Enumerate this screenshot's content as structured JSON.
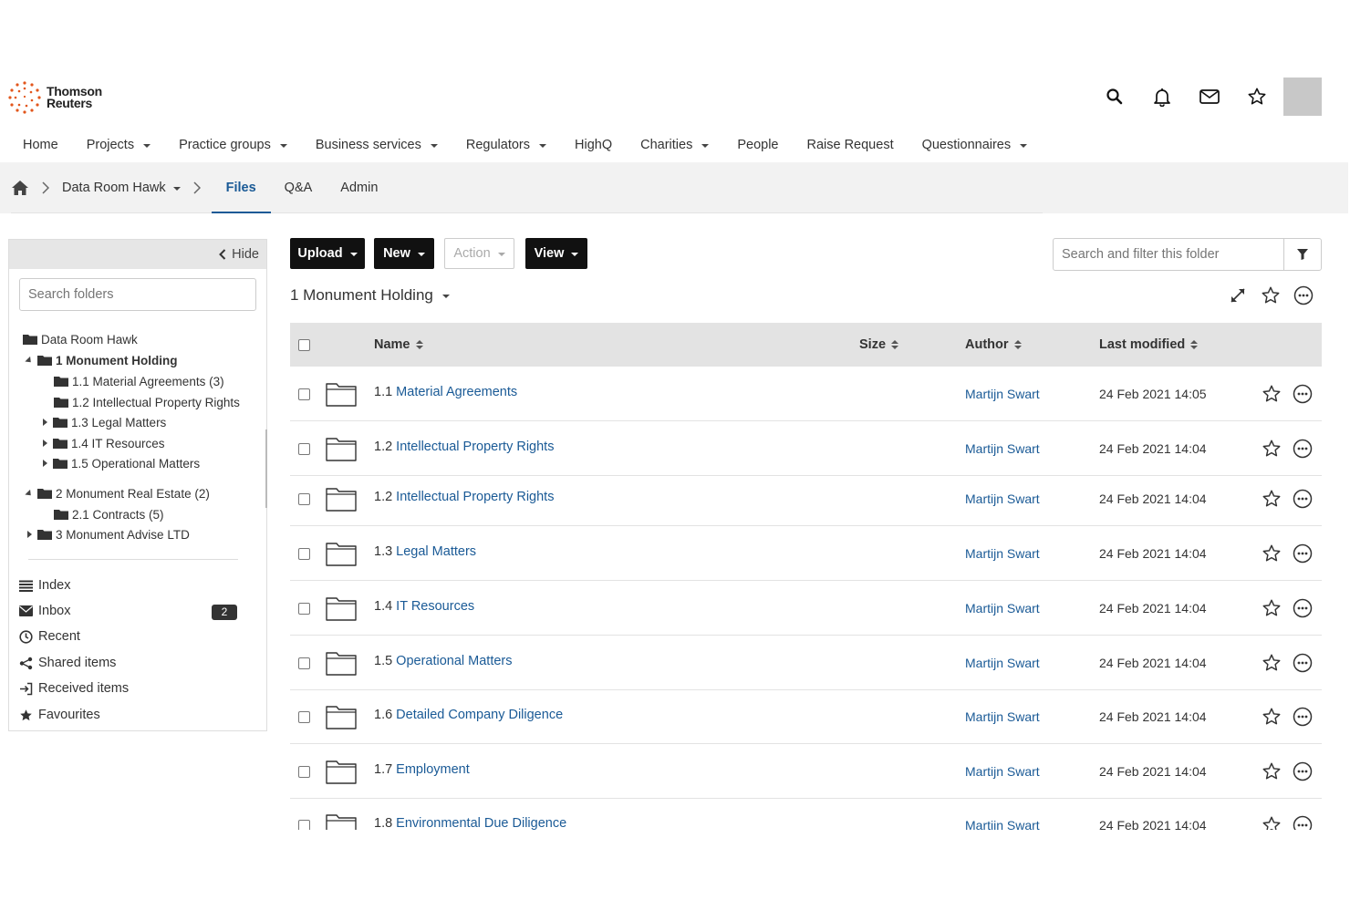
{
  "brand": {
    "name_line1": "Thomson",
    "name_line2": "Reuters"
  },
  "header_icons": [
    "search-icon",
    "bell-icon",
    "mail-icon",
    "star-icon"
  ],
  "topnav": [
    {
      "label": "Home",
      "dropdown": false
    },
    {
      "label": "Projects",
      "dropdown": true
    },
    {
      "label": "Practice groups",
      "dropdown": true
    },
    {
      "label": "Business services",
      "dropdown": true
    },
    {
      "label": "Regulators",
      "dropdown": true
    },
    {
      "label": "HighQ",
      "dropdown": false
    },
    {
      "label": "Charities",
      "dropdown": true
    },
    {
      "label": "People",
      "dropdown": false
    },
    {
      "label": "Raise Request",
      "dropdown": false
    },
    {
      "label": "Questionnaires",
      "dropdown": true
    }
  ],
  "breadcrumb": {
    "site": "Data Room Hawk",
    "tabs": [
      {
        "label": "Files",
        "active": true
      },
      {
        "label": "Q&A",
        "active": false
      },
      {
        "label": "Admin",
        "active": false
      }
    ]
  },
  "sidebar": {
    "hide_label": "Hide",
    "search_placeholder": "Search folders",
    "tree": [
      {
        "label": "Data Room Hawk",
        "level": 0,
        "toggle": "none",
        "bold": false
      },
      {
        "label": "1 Monument Holding",
        "level": 1,
        "toggle": "open",
        "bold": true
      },
      {
        "label": "1.1 Material Agreements (3)",
        "level": 2,
        "toggle": "none",
        "bold": false
      },
      {
        "label": "1.2 Intellectual Property Rights",
        "level": 2,
        "toggle": "none",
        "bold": false
      },
      {
        "label": "1.3 Legal Matters",
        "level": 2,
        "toggle": "closed",
        "bold": false
      },
      {
        "label": "1.4 IT Resources",
        "level": 2,
        "toggle": "closed",
        "bold": false
      },
      {
        "label": "1.5 Operational Matters",
        "level": 2,
        "toggle": "closed",
        "bold": false
      },
      {
        "label": "2 Monument Real Estate (2)",
        "level": 1,
        "toggle": "open",
        "bold": false
      },
      {
        "label": "2.1 Contracts (5)",
        "level": 2,
        "toggle": "none",
        "bold": false
      },
      {
        "label": "3 Monument Advise LTD",
        "level": 1,
        "toggle": "closed",
        "bold": false
      }
    ],
    "nav": [
      {
        "label": "Index",
        "icon": "list-icon"
      },
      {
        "label": "Inbox",
        "icon": "envelope-icon"
      },
      {
        "label": "Recent",
        "icon": "clock-icon"
      },
      {
        "label": "Shared items",
        "icon": "share-icon"
      },
      {
        "label": "Received items",
        "icon": "received-icon"
      },
      {
        "label": "Favourites",
        "icon": "star-filled-icon"
      }
    ],
    "inbox_count": "2"
  },
  "toolbar": {
    "upload": "Upload",
    "new": "New",
    "action": "Action",
    "view": "View",
    "filter_placeholder": "Search and filter this folder"
  },
  "folder": {
    "title": "1 Monument Holding"
  },
  "table": {
    "columns": {
      "name": "Name",
      "size": "Size",
      "author": "Author",
      "modified": "Last modified"
    },
    "rows": [
      {
        "num": "1.1",
        "name": "Material Agreements",
        "author": "Martijn Swart",
        "modified": "24 Feb 2021 14:05"
      },
      {
        "num": "1.2",
        "name": "Intellectual Property Rights",
        "author": "Martijn Swart",
        "modified": "24 Feb 2021 14:04"
      },
      {
        "num": "1.2",
        "name": "Intellectual Property Rights",
        "author": "Martijn Swart",
        "modified": "24 Feb 2021 14:04"
      },
      {
        "num": "1.3",
        "name": "Legal Matters",
        "author": "Martijn Swart",
        "modified": "24 Feb 2021 14:04"
      },
      {
        "num": "1.4",
        "name": "IT Resources",
        "author": "Martijn Swart",
        "modified": "24 Feb 2021 14:04"
      },
      {
        "num": "1.5",
        "name": "Operational Matters",
        "author": "Martijn Swart",
        "modified": "24 Feb 2021 14:04"
      },
      {
        "num": "1.6",
        "name": "Detailed Company Diligence",
        "author": "Martijn Swart",
        "modified": "24 Feb 2021 14:04"
      },
      {
        "num": "1.7",
        "name": "Employment",
        "author": "Martijn Swart",
        "modified": "24 Feb 2021 14:04"
      },
      {
        "num": "1.8",
        "name": "Environmental Due Diligence",
        "author": "Martijn Swart",
        "modified": "24 Feb 2021 14:04"
      }
    ]
  },
  "colors": {
    "link": "#1a5a96",
    "dark_button": "#111111",
    "header_row": "#e3e3e3",
    "crumb_bar": "#f2f2f2"
  }
}
